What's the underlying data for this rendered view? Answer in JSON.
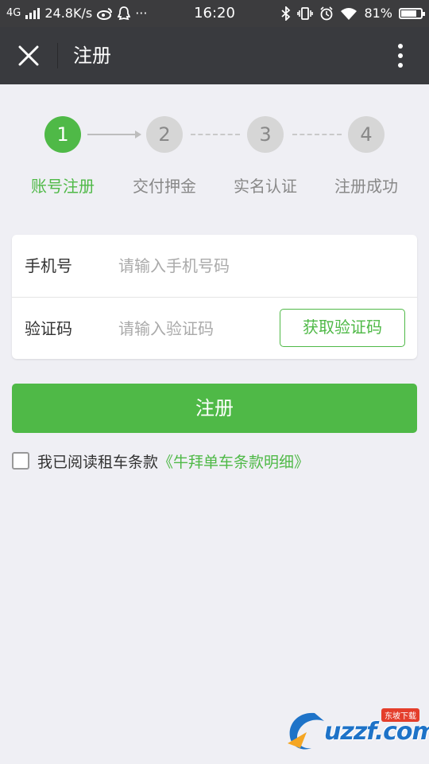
{
  "status_bar": {
    "network": "4G",
    "speed": "24.8K/s",
    "more": "···",
    "time": "16:20",
    "battery": "81%",
    "battery_level": 0.81
  },
  "header": {
    "title": "注册",
    "close_icon": "close-icon",
    "more_icon": "more-vertical-icon"
  },
  "stepper": {
    "steps": [
      {
        "number": "1",
        "label": "账号注册",
        "active": true
      },
      {
        "number": "2",
        "label": "交付押金",
        "active": false
      },
      {
        "number": "3",
        "label": "实名认证",
        "active": false
      },
      {
        "number": "4",
        "label": "注册成功",
        "active": false
      }
    ]
  },
  "form": {
    "phone": {
      "label": "手机号",
      "placeholder": "请输入手机号码",
      "value": ""
    },
    "code": {
      "label": "验证码",
      "placeholder": "请输入验证码",
      "value": "",
      "button": "获取验证码"
    }
  },
  "register_button": "注册",
  "agreement": {
    "checked": false,
    "text": "我已阅读租车条款",
    "link": "《牛拜单车条款明细》"
  },
  "watermark": {
    "text": "uzzf.com",
    "tag": "东坡下载"
  },
  "colors": {
    "accent": "#4fb947",
    "header_bg": "#393a3e",
    "page_bg": "#efeff4"
  }
}
